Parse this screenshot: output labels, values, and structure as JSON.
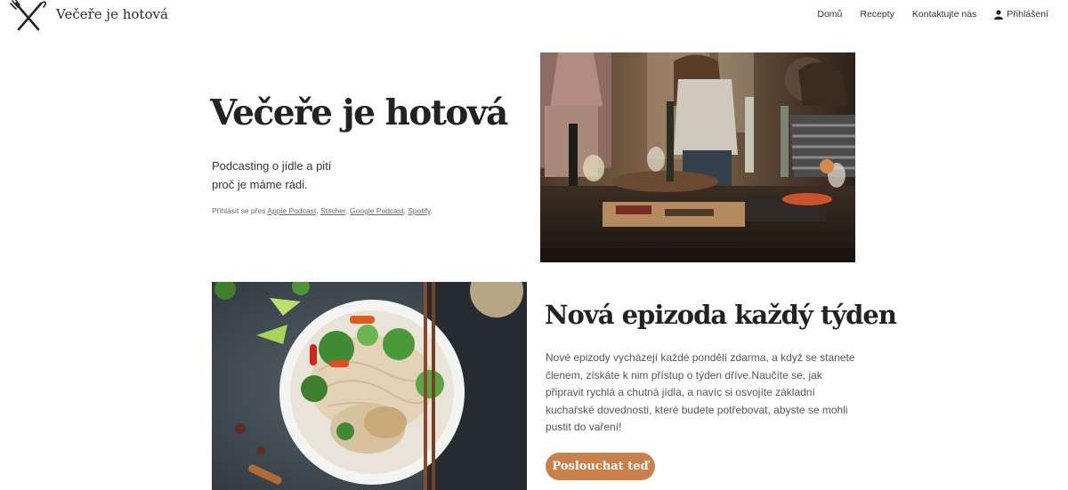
{
  "header": {
    "brand": "Večeře je hotová",
    "logo_icon": "fork-knife-icon",
    "nav": {
      "home": "Domů",
      "recipes": "Recepty",
      "contact": "Kontaktujte nás",
      "login": "Přihlášení",
      "login_icon": "user-icon"
    }
  },
  "hero": {
    "title": "Večeře je hotová",
    "subtitle_line1": "Podcasting o jídle a pití",
    "subtitle_line2": "proč je máme rádi.",
    "subscribe_prefix": "Přihlásit se přes ",
    "platforms": [
      "Apple Podcast",
      "Stitcher",
      "Google Podcast",
      "Spotify"
    ],
    "separator": ", ",
    "suffix": "."
  },
  "episode": {
    "title": "Nová epizoda každý týden",
    "text": "Nové epizody vycházejí každé pondělí zdarma, a když se stanete členem, získáte k nim přístup o týden dříve.Naučíte se, jak připravit rychlá a chutná jídla, a navíc si osvojíte základní kuchařské dovednosti, které budete potřebovat, abyste se mohli pustit do vaření!",
    "button": "Poslouchat teď"
  },
  "colors": {
    "accent": "#c9804b",
    "text_dark": "#222222",
    "text_muted": "#555555"
  }
}
